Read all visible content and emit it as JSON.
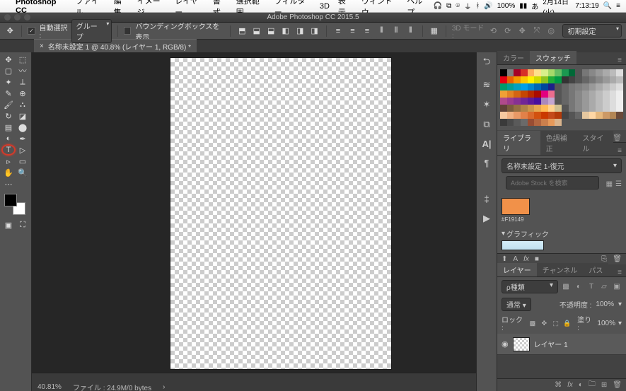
{
  "menubar": {
    "app": "Photoshop CC",
    "items": [
      "ファイル",
      "編集",
      "イメージ",
      "レイヤー",
      "書式",
      "選択範囲",
      "フィルター",
      "3D",
      "表示",
      "ウィンドウ",
      "ヘルプ"
    ],
    "battery": "100%",
    "date": "2月14日(火)",
    "time": "7:13:19"
  },
  "titlebar": {
    "title": "Adobe Photoshop CC 2015.5"
  },
  "optbar": {
    "autosel_label": "自動選択 :",
    "autosel_value": "グループ",
    "transform_label": "バウンディングボックスを表示",
    "mode3d_label": "3D モード :",
    "preset": "初期設定"
  },
  "tab": {
    "name": "名称未設定 1 @ 40.8% (レイヤー 1, RGB/8) *"
  },
  "status": {
    "zoom": "40.81%",
    "file": "ファイル : 24.9M/0 bytes"
  },
  "panels": {
    "color_tabs": [
      "カラー",
      "スウォッチ"
    ],
    "lib_tabs": [
      "ライブラリ",
      "色調補正",
      "スタイル"
    ],
    "lib_select": "名称未設定 1-復元",
    "lib_search_ph": "Adobe Stock を検索",
    "swatch_hex": "#F19149",
    "graphic_hdr": "グラフィック",
    "layer_tabs": [
      "レイヤー",
      "チャンネル",
      "パス"
    ],
    "kind": "ρ種類",
    "blend": "通常",
    "opacity_label": "不透明度 :",
    "opacity": "100%",
    "lock_label": "ロック :",
    "fill_label": "塗り :",
    "fill": "100%",
    "layer_name": "レイヤー 1"
  },
  "swatch_colors": [
    [
      "#000",
      "#7f7f7f",
      "#a50026",
      "#d73027",
      "#fdae61",
      "#fee08b",
      "#d9ef8b",
      "#a6d96a",
      "#66bd63",
      "#1a9850",
      "#006837",
      "#555",
      "#777",
      "#888",
      "#999",
      "#aaa",
      "#bbb",
      "#ddd"
    ],
    [
      "#e60012",
      "#eb6100",
      "#f39800",
      "#fcc800",
      "#fff100",
      "#cfdb00",
      "#8fc31f",
      "#22ac38",
      "#009944",
      "#333",
      "#444",
      "#555",
      "#666",
      "#777",
      "#888",
      "#999",
      "#aaa",
      "#bbb"
    ],
    [
      "#009b6b",
      "#009e96",
      "#00a0c1",
      "#00a0e9",
      "#0086d1",
      "#0068b7",
      "#00479d",
      "#1d2088",
      "#555",
      "#666",
      "#777",
      "#7f7f7f",
      "#888",
      "#999",
      "#aaa",
      "#bbb",
      "#ccc",
      "#ddd"
    ],
    [
      "#f0a035",
      "#e28224",
      "#d46413",
      "#c64602",
      "#b82800",
      "#aa0a00",
      "#e4007f",
      "#eb6d8e",
      "#555",
      "#666",
      "#777",
      "#888",
      "#999",
      "#aaa",
      "#bbb",
      "#ccc",
      "#ddd",
      "#eee"
    ],
    [
      "#b04a8b",
      "#9b3b8f",
      "#863093",
      "#712597",
      "#5c1a9b",
      "#47109f",
      "#aa89bd",
      "#c4a6d0",
      "#555",
      "#666",
      "#777",
      "#888",
      "#999",
      "#aaa",
      "#bbb",
      "#ccc",
      "#ddd",
      "#eee"
    ],
    [
      "#5f4238",
      "#7a5c3d",
      "#956f42",
      "#b08247",
      "#cb954c",
      "#e6a851",
      "#ffbb56",
      "#ffd28f",
      "#d0c090",
      "#555",
      "#777",
      "#888",
      "#999",
      "#aaa",
      "#bbb",
      "#ccc",
      "#ddd",
      "#eee"
    ],
    [
      "#f7c9a0",
      "#f0b183",
      "#e89966",
      "#e18149",
      "#d9692c",
      "#d2510f",
      "#ca3900",
      "#c44a1a",
      "#b33b0a",
      "#444",
      "#555",
      "#666",
      "#e6c8a0",
      "#ffd7a5",
      "#e6b87d",
      "#cc9966",
      "#b38655",
      "#6a4a3a"
    ],
    [
      "#3a3a3a",
      "#4a4a4a",
      "#5a5a5a",
      "#6a6a6a",
      "#994d33",
      "#b36640",
      "#cc804d",
      "#e6995a",
      "#d9b38c",
      "",
      "",
      "",
      "",
      "",
      "",
      "",
      "",
      ""
    ]
  ]
}
